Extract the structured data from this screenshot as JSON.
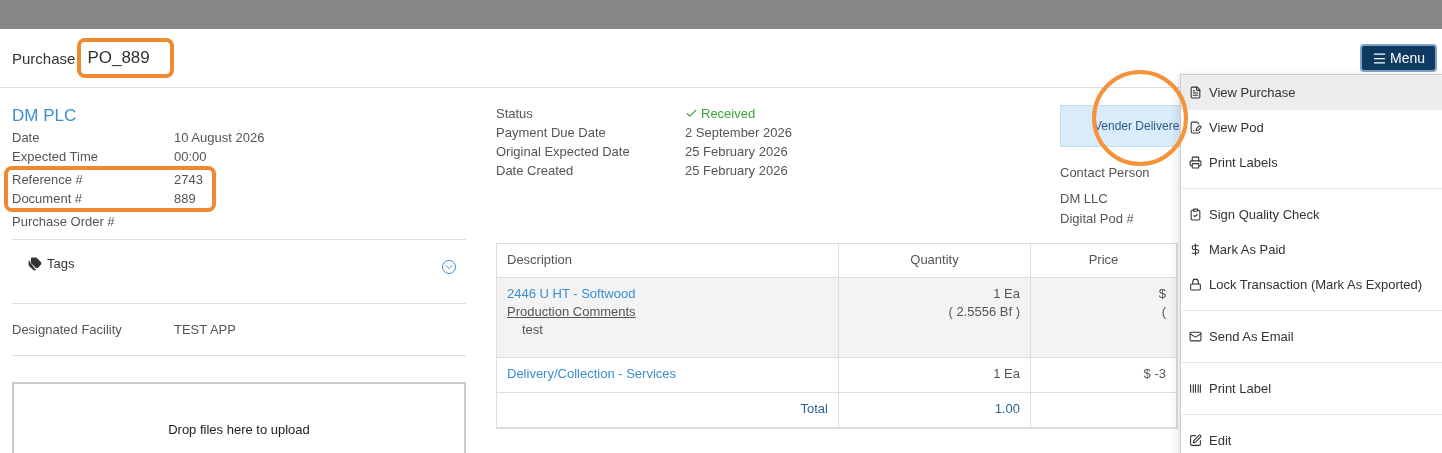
{
  "header": {
    "title_prefix": "Purchase",
    "number": "PO_889",
    "number_highlighted": true,
    "menu_label": "Menu"
  },
  "vendor": {
    "name": "DM PLC",
    "fields": [
      {
        "label": "Date",
        "value": "10 August 2026",
        "highlighted": false
      },
      {
        "label": "Expected Time",
        "value": "00:00",
        "highlighted": false
      },
      {
        "label": "Reference #",
        "value": "2743",
        "highlighted": true
      },
      {
        "label": "Document #",
        "value": "889",
        "highlighted": true
      },
      {
        "label": "Purchase Order #",
        "highlighted": false
      }
    ]
  },
  "tags": {
    "label": "Tags",
    "expanded": false
  },
  "facility": {
    "label": "Designated Facility",
    "value": "TEST APP"
  },
  "dropzone": {
    "text": "Drop files here to upload"
  },
  "details": [
    {
      "label": "Status",
      "value": "Received",
      "kind": "status"
    },
    {
      "label": "Payment Due Date",
      "value": "2 September 2026",
      "kind": "text"
    },
    {
      "label": "Original Expected Date",
      "value": "25 February 2026",
      "kind": "text"
    },
    {
      "label": "Date Created",
      "value": "25 February 2026",
      "kind": "text"
    }
  ],
  "delivery": {
    "badge": "Vender Delivere",
    "contact_label": "Contact Person",
    "contact_lines": [
      "DM LLC",
      "Digital Pod #"
    ]
  },
  "table": {
    "columns": [
      "Description",
      "Quantity",
      "Price"
    ],
    "rows": [
      {
        "description": "2446 U HT - Softwood",
        "comment_label": "Production Comments",
        "comment": "test",
        "quantity": [
          "1 Ea",
          "( 2.5556 Bf )"
        ],
        "price": [
          "$",
          "("
        ],
        "shaded": true
      },
      {
        "description": "Delivery/Collection - Services",
        "quantity": [
          "1 Ea"
        ],
        "price": [
          "$ -3"
        ],
        "shaded": false
      }
    ],
    "total": {
      "label": "Total",
      "quantity": "1.00"
    }
  },
  "menu": {
    "circled": true,
    "sections": [
      [
        {
          "label": "View Purchase",
          "selected": true
        },
        {
          "label": "View Pod",
          "selected": false
        },
        {
          "label": "Print Labels",
          "selected": false
        }
      ],
      [
        {
          "label": "Sign Quality Check",
          "selected": false
        },
        {
          "label": "Mark As Paid",
          "selected": false
        },
        {
          "label": "Lock Transaction (Mark As Exported)",
          "selected": false
        }
      ],
      [
        {
          "label": "Send As Email",
          "selected": false
        }
      ],
      [
        {
          "label": "Print Label",
          "selected": false
        }
      ],
      [
        {
          "label": "Edit",
          "selected": false
        }
      ]
    ]
  }
}
